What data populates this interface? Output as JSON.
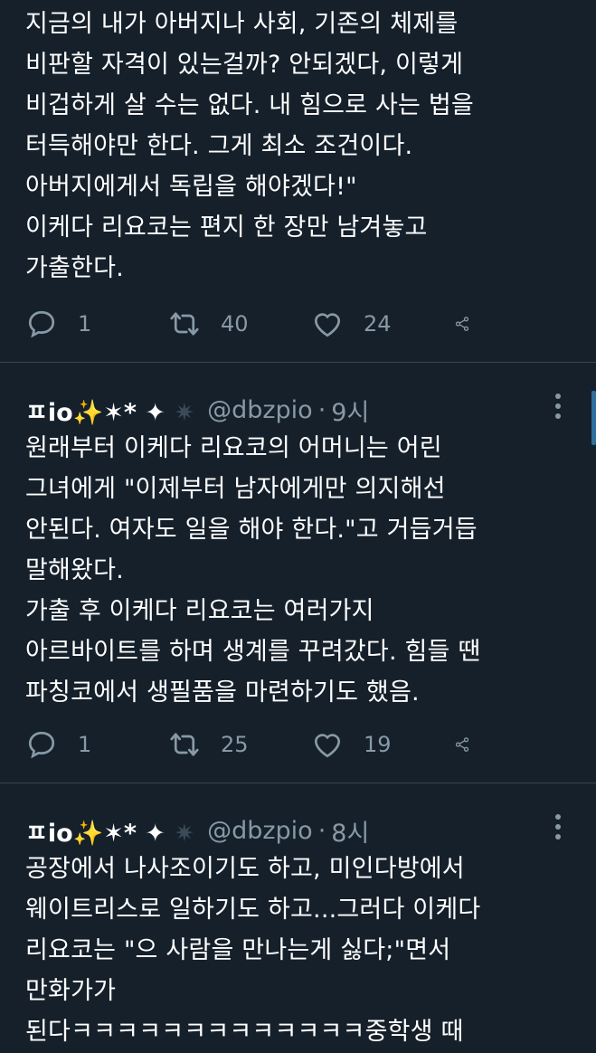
{
  "tweets": [
    {
      "text": "지금의 내가 아버지나 사회, 기존의 체제를\n비판할 자격이 있는걸까? 안되겠다, 이렇게\n비겁하게 살 수는 없다. 내 힘으로 사는 법을\n터득해야만 한다. 그게 최소 조건이다.\n아버지에게서 독립을 해야겠다!\"\n이케다 리요코는 편지 한 장만 남겨놓고\n가출한다.",
      "replies": "1",
      "retweets": "40",
      "likes": "24"
    },
    {
      "name_prefix": "ㅍio",
      "name_sparkle": "✨",
      "name_suffix": "✶* ✦",
      "name_dim": "✷",
      "handle": "@dbzpio",
      "time": "9시",
      "text": "원래부터 이케다 리요코의 어머니는 어린\n그녀에게 \"이제부터 남자에게만 의지해선\n안된다. 여자도 일을 해야 한다.\"고 거듭거듭\n말해왔다.\n가출 후 이케다 리요코는 여러가지\n아르바이트를 하며 생계를 꾸려갔다. 힘들 땐\n파칭코에서 생필품을 마련하기도 했음.",
      "replies": "1",
      "retweets": "25",
      "likes": "19"
    },
    {
      "name_prefix": "ㅍio",
      "name_sparkle": "✨",
      "name_suffix": "✶* ✦",
      "name_dim": "✷",
      "handle": "@dbzpio",
      "time": "8시",
      "text": "공장에서 나사조이기도 하고, 미인다방에서\n웨이트리스로 일하기도 하고...그러다 이케다\n리요코는 \"으 사람을 만나는게 싫다;\"면서\n만화가가\n된다ㅋㅋㅋㅋㅋㅋㅋㅋㅋㅋㅋㅋㅋ중학생 때"
    }
  ],
  "icons": {
    "reply": "reply-icon",
    "retweet": "retweet-icon",
    "like": "heart-icon",
    "share": "share-icon",
    "more": "more-icon"
  },
  "colors": {
    "background": "#15202b",
    "text": "#ffffff",
    "secondary": "#8899a6",
    "divider": "#38444d"
  }
}
